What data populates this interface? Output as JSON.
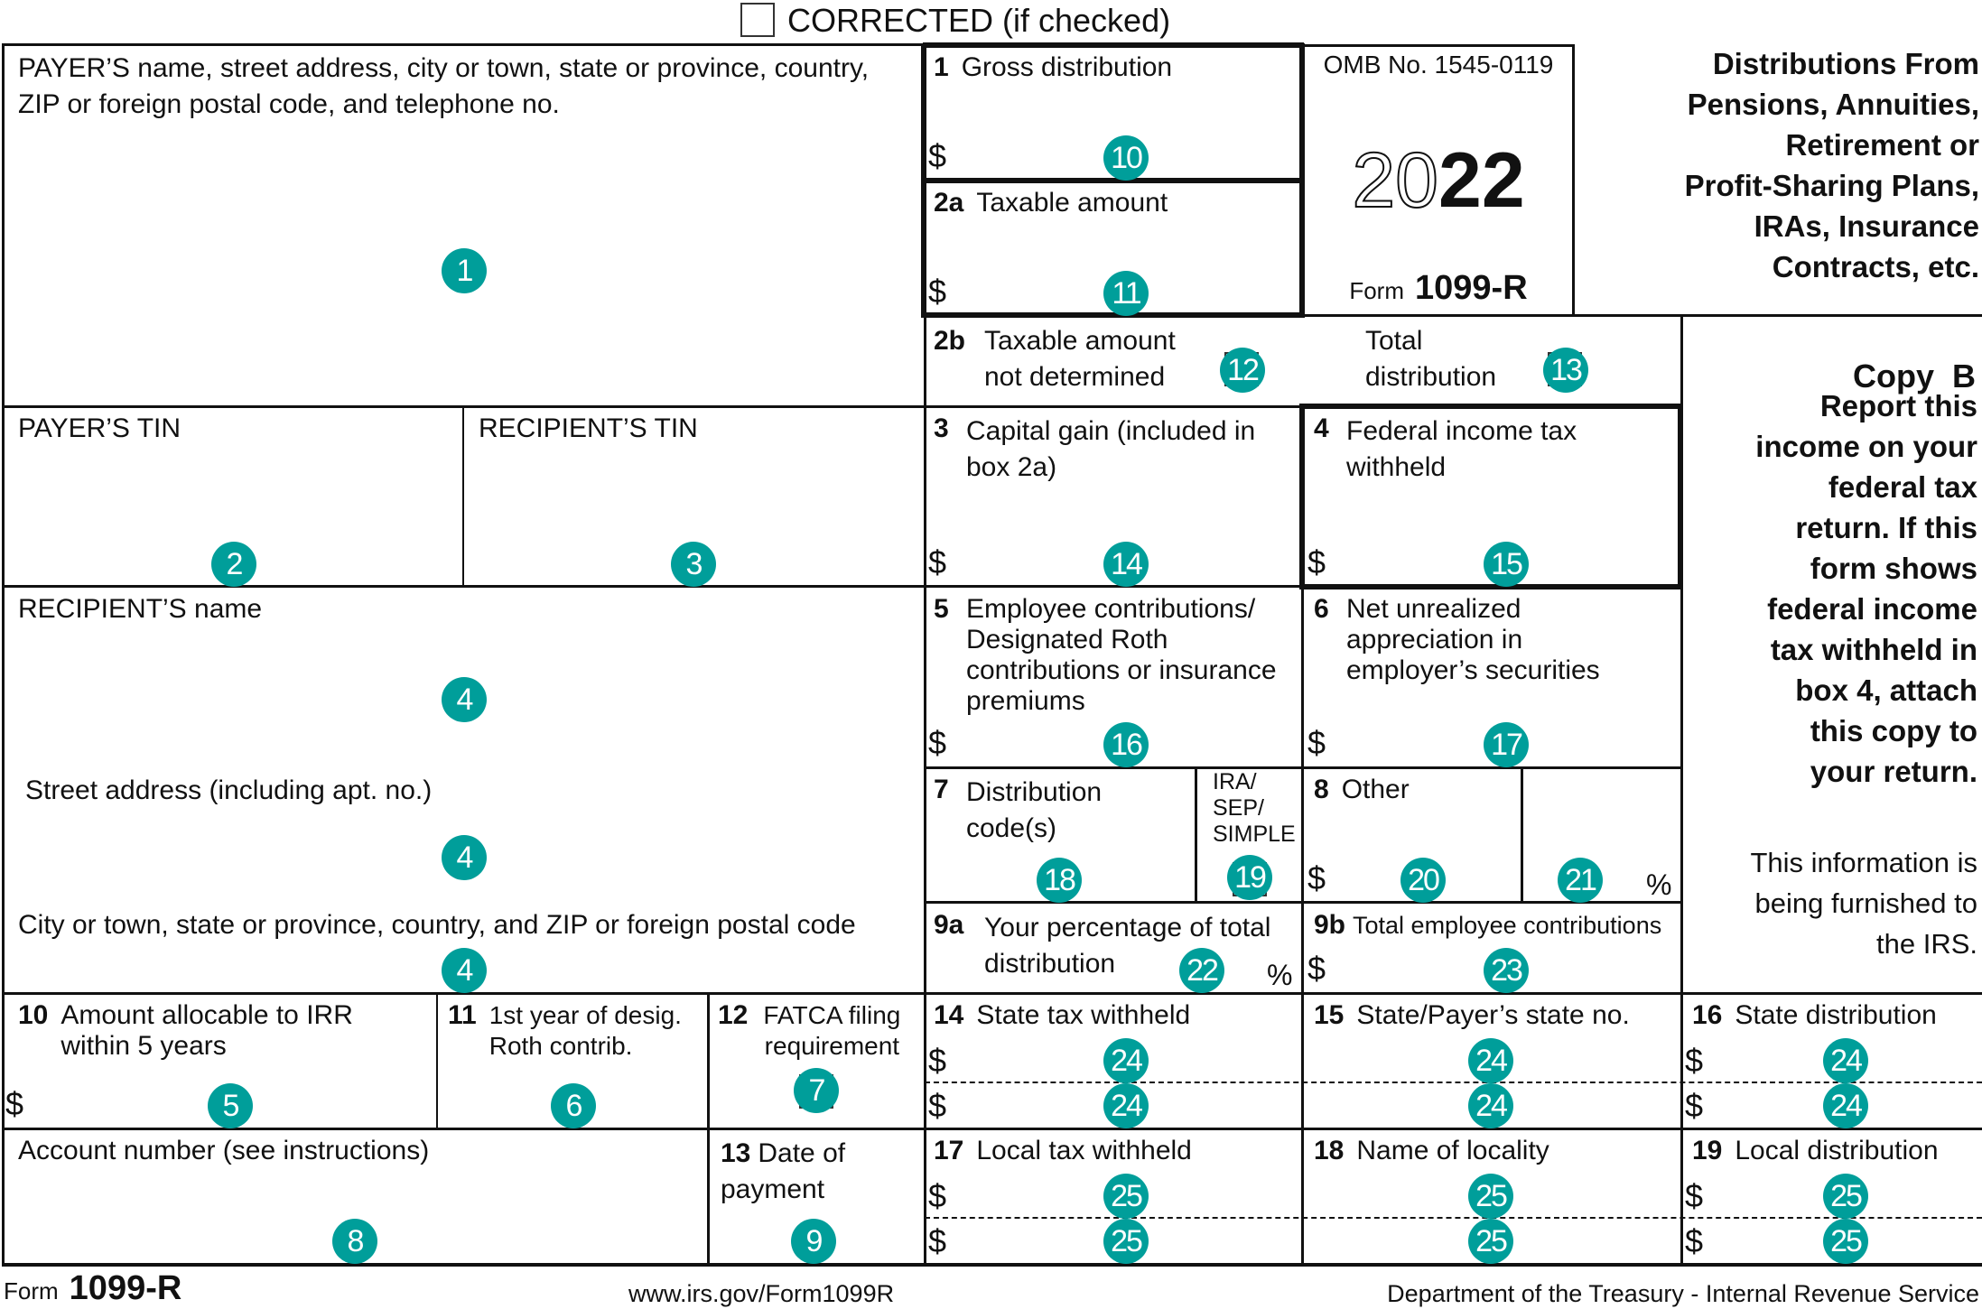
{
  "header": {
    "corrected_label": "CORRECTED (if checked)",
    "corrected_checked": false
  },
  "payer": {
    "label": "PAYER’S name, street address, city or town, state or province, country, ZIP or foreign postal code, and telephone no.",
    "badge": "1"
  },
  "payer_tin": {
    "label": "PAYER’S TIN",
    "badge": "2"
  },
  "recipient_tin": {
    "label": "RECIPIENT’S TIN",
    "badge": "3"
  },
  "recipient": {
    "name_label": "RECIPIENT’S name",
    "name_badge": "4",
    "street_label": "Street address (including apt. no.)",
    "street_badge": "4",
    "city_label": "City or town, state or province, country, and ZIP or foreign postal code",
    "city_badge": "4"
  },
  "box10": {
    "num": "10",
    "label": "Amount allocable to IRR within 5 years",
    "currency": "$",
    "badge": "5"
  },
  "box11": {
    "num": "11",
    "label": "1st year of desig. Roth contrib.",
    "badge": "6"
  },
  "box12": {
    "num": "12",
    "label": "FATCA filing requirement",
    "badge": "7"
  },
  "account": {
    "label": "Account number (see instructions)",
    "badge": "8"
  },
  "box13": {
    "num": "13",
    "label": "Date of payment",
    "badge": "9"
  },
  "box1": {
    "num": "1",
    "label": "Gross distribution",
    "currency": "$",
    "badge": "10"
  },
  "box2a": {
    "num": "2a",
    "label": "Taxable amount",
    "currency": "$",
    "badge": "11"
  },
  "box2b": {
    "num": "2b",
    "label": "Taxable amount not determined",
    "badge": "12",
    "total_label": "Total distribution",
    "total_badge": "13"
  },
  "box3": {
    "num": "3",
    "label": "Capital gain (included in box 2a)",
    "currency": "$",
    "badge": "14"
  },
  "box4": {
    "num": "4",
    "label": "Federal income tax withheld",
    "currency": "$",
    "badge": "15"
  },
  "box5": {
    "num": "5",
    "label": "Employee contributions/ Designated Roth contributions or insurance premiums",
    "currency": "$",
    "badge": "16"
  },
  "box6": {
    "num": "6",
    "label": "Net unrealized appreciation in employer’s securities",
    "currency": "$",
    "badge": "17"
  },
  "box7": {
    "num": "7",
    "label": "Distribution code(s)",
    "badge": "18",
    "ira_label": "IRA/ SEP/ SIMPLE",
    "ira_badge": "19"
  },
  "box8": {
    "num": "8",
    "label": "Other",
    "currency": "$",
    "badge": "20",
    "pct_badge": "21",
    "pct_sign": "%"
  },
  "box9a": {
    "num": "9a",
    "label": "Your percentage of total distribution",
    "badge": "22",
    "pct_sign": "%"
  },
  "box9b": {
    "num": "9b",
    "label": "Total employee contributions",
    "currency": "$",
    "badge": "23"
  },
  "box14": {
    "num": "14",
    "label": "State tax withheld",
    "currency": "$",
    "badges": [
      "24",
      "24"
    ]
  },
  "box15": {
    "num": "15",
    "label": "State/Payer’s state no.",
    "badges": [
      "24",
      "24"
    ]
  },
  "box16": {
    "num": "16",
    "label": "State distribution",
    "currency": "$",
    "badges": [
      "24",
      "24"
    ]
  },
  "box17": {
    "num": "17",
    "label": "Local tax withheld",
    "currency": "$",
    "badges": [
      "25",
      "25"
    ]
  },
  "box18": {
    "num": "18",
    "label": "Name of locality",
    "badges": [
      "25",
      "25"
    ]
  },
  "box19": {
    "num": "19",
    "label": "Local distribution",
    "currency": "$",
    "badges": [
      "25",
      "25"
    ]
  },
  "omb": {
    "omb_no": "OMB No. 1545-0119",
    "year_outline": "20",
    "year_bold": "22",
    "form_prefix": "Form",
    "form_name": "1099-R"
  },
  "title": {
    "lines": [
      "Distributions From",
      "Pensions, Annuities,",
      "Retirement or",
      "Profit-Sharing Plans,",
      "IRAs, Insurance",
      "Contracts, etc."
    ]
  },
  "copy": {
    "label": "Copy  B",
    "instructions": [
      "Report this",
      "income on your",
      "federal tax",
      "return. If this",
      "form shows",
      "federal income",
      "tax withheld in",
      "box 4, attach",
      "this copy to",
      "your return."
    ],
    "note": [
      "This information is",
      "being furnished to",
      "the IRS."
    ]
  },
  "footer": {
    "form_prefix": "Form",
    "form_name": "1099-R",
    "url": "www.irs.gov/Form1099R",
    "agency": "Department of the Treasury - Internal Revenue Service"
  },
  "colors": {
    "badge": "#009e9a",
    "ink": "#111111"
  }
}
